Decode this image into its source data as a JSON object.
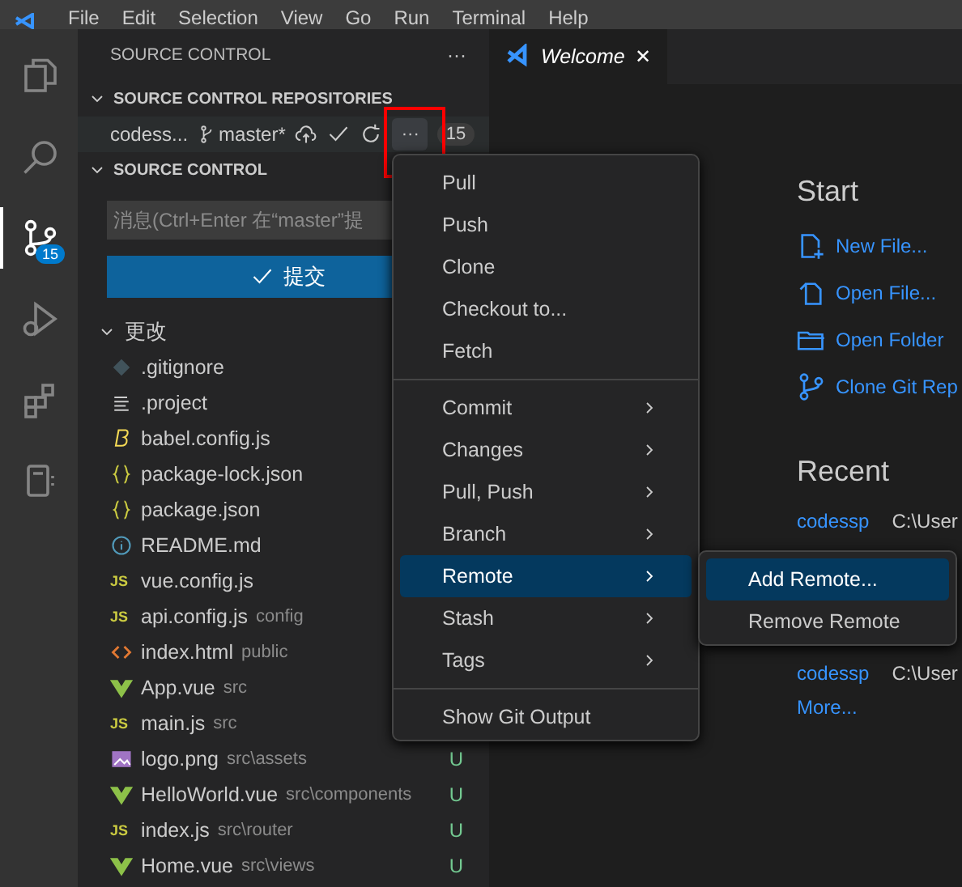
{
  "menubar": [
    "File",
    "Edit",
    "Selection",
    "View",
    "Go",
    "Run",
    "Terminal",
    "Help"
  ],
  "activity_bar": [
    {
      "kind": "files",
      "selected": false
    },
    {
      "kind": "search",
      "selected": false
    },
    {
      "kind": "scm",
      "selected": true,
      "badge": "15"
    },
    {
      "kind": "run",
      "selected": false
    },
    {
      "kind": "extensions",
      "selected": false
    },
    {
      "kind": "remote",
      "selected": false
    }
  ],
  "sidebar": {
    "title": "SOURCE CONTROL",
    "more": "···",
    "repositories": {
      "title": "SOURCE CONTROL REPOSITORIES",
      "repo": {
        "name": "codess...",
        "branch": "master*",
        "more": "···",
        "count": "15"
      }
    },
    "scm": {
      "title": "SOURCE CONTROL",
      "message_placeholder": "消息(Ctrl+Enter 在“master”提",
      "commit_button": "提交",
      "changes": {
        "title": "更改",
        "files": [
          {
            "name": ".gitignore",
            "kind": "git"
          },
          {
            "name": ".project",
            "kind": "lines"
          },
          {
            "name": "babel.config.js",
            "kind": "babel"
          },
          {
            "name": "package-lock.json",
            "kind": "json"
          },
          {
            "name": "package.json",
            "kind": "json"
          },
          {
            "name": "README.md",
            "kind": "info"
          },
          {
            "name": "vue.config.js",
            "kind": "js",
            "icon_text": "JS"
          },
          {
            "name": "api.config.js",
            "path": "config",
            "kind": "js",
            "icon_text": "JS"
          },
          {
            "name": "index.html",
            "path": "public",
            "kind": "html"
          },
          {
            "name": "App.vue",
            "path": "src",
            "kind": "vue"
          },
          {
            "name": "main.js",
            "path": "src",
            "kind": "js",
            "icon_text": "JS"
          },
          {
            "name": "logo.png",
            "path": "src\\assets",
            "kind": "image",
            "status": "U"
          },
          {
            "name": "HelloWorld.vue",
            "path": "src\\components",
            "kind": "vue",
            "status": "U"
          },
          {
            "name": "index.js",
            "path": "src\\router",
            "kind": "js",
            "icon_text": "JS",
            "status": "U"
          },
          {
            "name": "Home.vue",
            "path": "src\\views",
            "kind": "vue",
            "status": "U"
          }
        ]
      }
    }
  },
  "editor": {
    "tab": {
      "title": "Welcome",
      "close": "✕"
    },
    "start": {
      "title": "Start",
      "links": [
        {
          "label": "New File...",
          "kind": "new-file"
        },
        {
          "label": "Open File...",
          "kind": "open-file"
        },
        {
          "label": "Open Folder",
          "kind": "folder"
        },
        {
          "label": "Clone Git Rep",
          "kind": "git"
        }
      ]
    },
    "recent": {
      "title": "Recent",
      "items": [
        {
          "name": "codessp",
          "path": "C:\\User"
        },
        {
          "name": "codessp",
          "path": "C:\\User"
        }
      ],
      "more": "More..."
    }
  },
  "context_menu": {
    "items": [
      {
        "kind": "item",
        "label": "Pull",
        "selected": false
      },
      {
        "kind": "item",
        "label": "Push",
        "selected": false
      },
      {
        "kind": "item",
        "label": "Clone",
        "selected": false
      },
      {
        "kind": "item",
        "label": "Checkout to...",
        "selected": false
      },
      {
        "kind": "item",
        "label": "Fetch",
        "selected": false
      },
      {
        "kind": "separator"
      },
      {
        "kind": "submenu",
        "label": "Commit",
        "selected": false
      },
      {
        "kind": "submenu",
        "label": "Changes",
        "selected": false
      },
      {
        "kind": "submenu",
        "label": "Pull, Push",
        "selected": false
      },
      {
        "kind": "submenu",
        "label": "Branch",
        "selected": false
      },
      {
        "kind": "submenu",
        "label": "Remote",
        "selected": true
      },
      {
        "kind": "submenu",
        "label": "Stash",
        "selected": false
      },
      {
        "kind": "submenu",
        "label": "Tags",
        "selected": false
      },
      {
        "kind": "separator"
      },
      {
        "kind": "item",
        "label": "Show Git Output",
        "selected": false
      }
    ]
  },
  "submenu": {
    "items": [
      {
        "label": "Add Remote...",
        "selected": true
      },
      {
        "label": "Remove Remote",
        "selected": false
      }
    ]
  }
}
